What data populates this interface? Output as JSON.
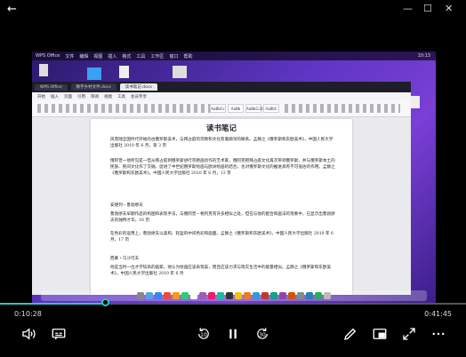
{
  "window": {
    "back_icon": "back-arrow-icon"
  },
  "video": {
    "desktop": {
      "menubar": {
        "app": "WPS Office",
        "items": [
          "文件",
          "编辑",
          "视图",
          "插入",
          "格式",
          "工具",
          "工作区",
          "窗口",
          "帮助"
        ],
        "time": "10:13"
      },
      "wps": {
        "tabs": [
          "WPS Office",
          "数字乡村文件.docx",
          "读书笔记.docx"
        ],
        "menu": [
          "开始",
          "插入",
          "页面",
          "引用",
          "审阅",
          "视图",
          "工具",
          "会员专享"
        ],
        "styles": [
          "AaBbCc",
          "AaBb",
          "AaBbCcD",
          "AaBbC"
        ]
      },
      "document": {
        "title": "读书笔记",
        "paragraphs": [
          "风景随全国时代开始的古俄罗斯美术，与拜占庭的宗教和文化有着颇深的联系。孟静之《俄罗斯和东欧美术》，中国人民大学出版社 2010 年 6 月，第 3 页",
          "俄阿普一他所见是一但从拜占庭到俄罗斯进行宗教画创作的艺术家，俄阿克把拜占庭文化再次带到俄罗斯，并与俄罗斯本土的民族、民间文化作了交融，促进了中世纪俄罗斯绘画与欧洲绘画的结合，也对俄罗斯文化的推进具有不可低估的作用。孟静之《俄罗斯和东欧美术》，中国人民大学出版社 2010 年 6 月，13 页",
          "安德列・鲁勃廖夫",
          "鲁勃廖夫早期作品的构图和表现手法，与俄阿普・格列克有许多相似之处，但在与他的配合和画法的现象中，已显示出鲁勃廖夫的独特才华。16 页",
          "在色彩的运用上，鲁勃廖夫以柔和、轻盈的中间色彩和画面。孟静之《俄罗斯和东欧美术》，中国人民大学出版社 2010 年 6 月，17 页",
          "西蒙・乌沙可夫",
          "他是当时一位才学较高的画家，他认为绘画应该表现美，而且应该力求与现实生活中的能量相似。孟静之《俄罗斯和东欧美术》，中国人民大学出版社 2010 年 6 月"
        ]
      }
    }
  },
  "player": {
    "current_time": "0:10:28",
    "total_time": "0:41:45",
    "progress": 0.25,
    "accent": "#2ec4c8",
    "skip_back": "10",
    "skip_forward": "30",
    "controls": [
      "volume-icon",
      "subtitles-icon",
      "skip-back-icon",
      "pause-icon",
      "skip-forward-icon",
      "edit-icon",
      "miniplayer-icon",
      "fullscreen-icon",
      "more-icon"
    ]
  }
}
